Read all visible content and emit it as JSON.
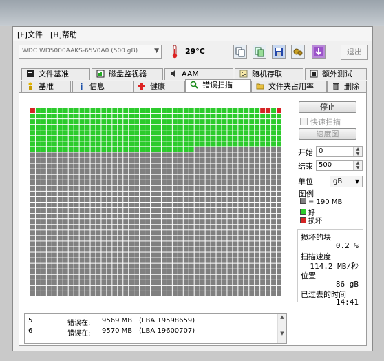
{
  "menu": {
    "file": "[F]文件",
    "help": "[H]帮助"
  },
  "toolbar": {
    "drive": "WDC WD5000AAKS-65V0A0 (500 gB)",
    "temperature": "29°C",
    "exit_label": "退出"
  },
  "tabs_top": [
    {
      "label": "文件基准",
      "icon": "file-benchmark-icon"
    },
    {
      "label": "磁盘监视器",
      "icon": "disk-monitor-icon"
    },
    {
      "label": "AAM",
      "icon": "speaker-icon"
    },
    {
      "label": "随机存取",
      "icon": "random-access-icon"
    },
    {
      "label": "额外测试",
      "icon": "extra-tests-icon"
    }
  ],
  "tabs_bottom": [
    {
      "label": "基准",
      "icon": "benchmark-icon"
    },
    {
      "label": "信息",
      "icon": "info-icon"
    },
    {
      "label": "健康",
      "icon": "health-cross-icon"
    },
    {
      "label": "错误扫描",
      "icon": "error-scan-icon",
      "active": true
    },
    {
      "label": "文件夹占用率",
      "icon": "folder-icon"
    },
    {
      "label": "删除",
      "icon": "trash-icon"
    }
  ],
  "scan": {
    "stop_label": "停止",
    "quick_scan_label": "快速扫描",
    "quick_scan_checked": false,
    "speed_map_label": "速度图",
    "start_label": "开始",
    "start_value": "0",
    "end_label": "结束",
    "end_value": "500",
    "unit_label": "单位",
    "unit_value": "gB",
    "legend_title": "图例",
    "legend_block": "= 190 MB",
    "legend_good": "好",
    "legend_bad": "损坏",
    "colors": {
      "good": "#2ccb2c",
      "bad": "#d42424",
      "pending": "#808080",
      "grid_line": "#404040"
    },
    "grid": {
      "columns": 46,
      "rows": 34,
      "total_blocks": 1564,
      "scanned_blocks": 352,
      "bad_blocks": [
        0,
        42,
        43,
        45
      ]
    }
  },
  "stats": {
    "damaged_label": "损坏的块",
    "damaged_value": "0.2 %",
    "speed_label": "扫描速度",
    "speed_value": "114.2 MB/秒",
    "position_label": "位置",
    "position_value": "86 gB",
    "elapsed_label": "已过去的时间",
    "elapsed_value": "14:41"
  },
  "log": [
    {
      "index": "5",
      "label": "错误在:",
      "mb": "9569 MB",
      "lba": "(LBA 19598659)"
    },
    {
      "index": "6",
      "label": "错误在:",
      "mb": "9570 MB",
      "lba": "(LBA 19600707)"
    }
  ]
}
